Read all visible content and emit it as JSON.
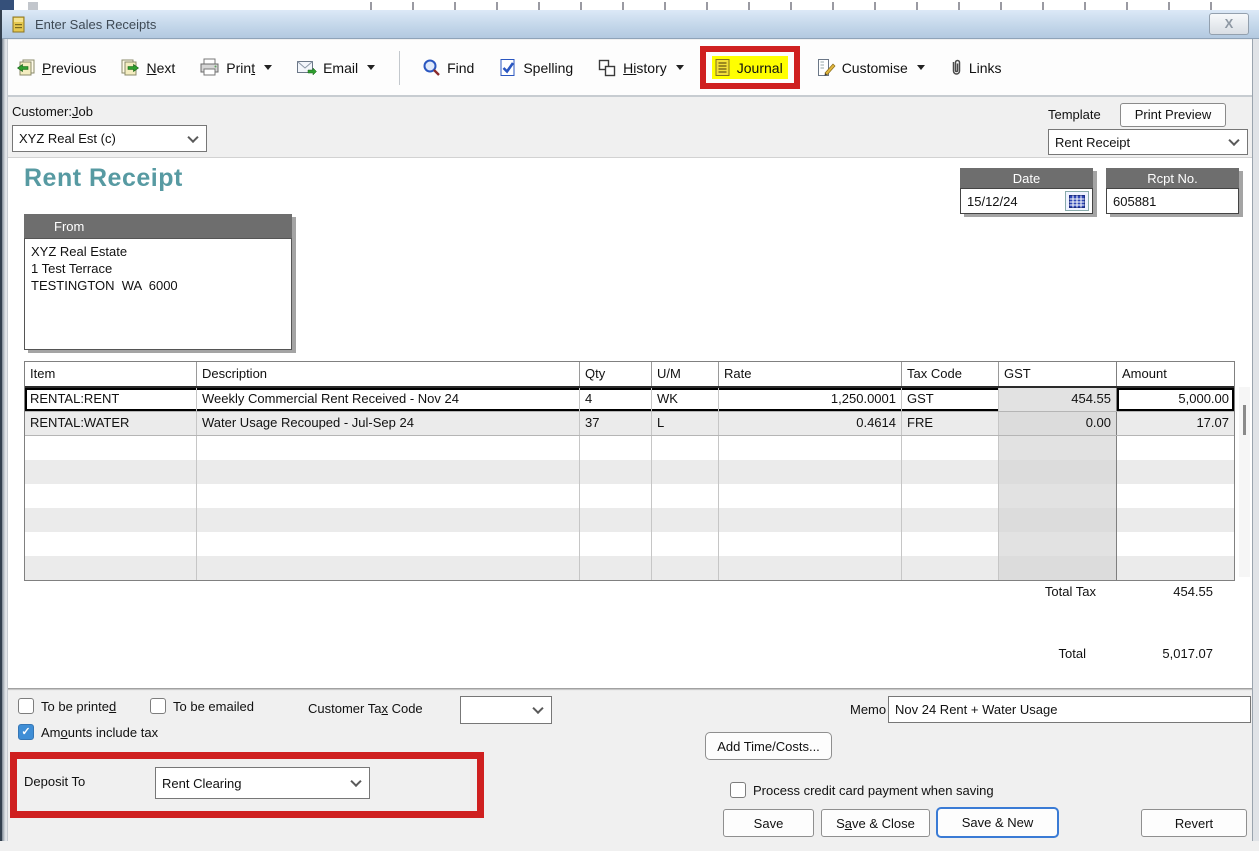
{
  "window": {
    "title": "Enter Sales Receipts",
    "close": "X"
  },
  "toolbar": {
    "previous": {
      "pre": "",
      "key": "P",
      "post": "revious"
    },
    "next": {
      "pre": "",
      "key": "N",
      "post": "ext"
    },
    "print": {
      "pre": "Prin",
      "key": "t",
      "post": ""
    },
    "email": {
      "label": "Email"
    },
    "find": {
      "label": "Find"
    },
    "spelling": {
      "pre": "Spellin",
      "key": "g",
      "post": ""
    },
    "history": {
      "pre": "H",
      "key": "i",
      "post": "story"
    },
    "journal": {
      "label": "Journal"
    },
    "customise": {
      "label": "Customise"
    },
    "links": {
      "label": "Links"
    }
  },
  "header": {
    "customer_job": {
      "pre": "Customer:",
      "key": "J",
      "post": "ob"
    },
    "customer_value": "XYZ Real Est (c)",
    "template_label": "Template",
    "print_preview": "Print Preview",
    "template_value": "Rent Receipt"
  },
  "receipt": {
    "title": "Rent Receipt",
    "date_label": "Date",
    "date_value": "15/12/24",
    "rcpt_label": "Rcpt No.",
    "rcpt_value": "605881",
    "from_label": "From",
    "from_lines": [
      "XYZ Real Estate",
      "1 Test Terrace",
      "TESTINGTON  WA  6000"
    ]
  },
  "table": {
    "columns": [
      "Item",
      "Description",
      "Qty",
      "U/M",
      "Rate",
      "Tax Code",
      "GST",
      "Amount"
    ],
    "rows": [
      {
        "item": "RENTAL:RENT",
        "description": "Weekly Commercial Rent Received - Nov 24",
        "qty": "4",
        "um": "WK",
        "rate": "1,250.0001",
        "tax_code": "GST",
        "gst": "454.55",
        "amount": "5,000.00"
      },
      {
        "item": "RENTAL:WATER",
        "description": "Water Usage Recouped - Jul-Sep 24",
        "qty": "37",
        "um": "L",
        "rate": "0.4614",
        "tax_code": "FRE",
        "gst": "0.00",
        "amount": "17.07"
      }
    ],
    "total_tax_label": "Total Tax",
    "total_tax_value": "454.55",
    "total_label": "Total",
    "total_value": "5,017.07"
  },
  "footer": {
    "to_be_printed": {
      "pre": "To be printe",
      "key": "d",
      "post": ""
    },
    "to_be_emailed": "To be emailed",
    "customer_tax_code": {
      "pre": "Customer Ta",
      "key": "x",
      "post": " Code"
    },
    "amounts_include_tax": {
      "pre": "Am",
      "key": "o",
      "post": "unts include tax"
    },
    "amounts_check": "✓",
    "memo_label": "Memo",
    "memo_value": "Nov 24 Rent + Water Usage",
    "add_time_costs": "Add Time/Costs...",
    "deposit_to_label": "Deposit To",
    "deposit_to_value": "Rent Clearing",
    "process_cc": "Process credit card payment when saving",
    "save": "Save",
    "save_close": {
      "pre": "S",
      "key": "a",
      "post": "ve & Close"
    },
    "save_new": "Save & New",
    "revert": "Revert"
  },
  "colors": {
    "accent_teal": "#579aa2",
    "annotation_red": "#cf2020",
    "highlight_yellow": "#ffff00",
    "box_header_gray": "#6e6e6e"
  }
}
